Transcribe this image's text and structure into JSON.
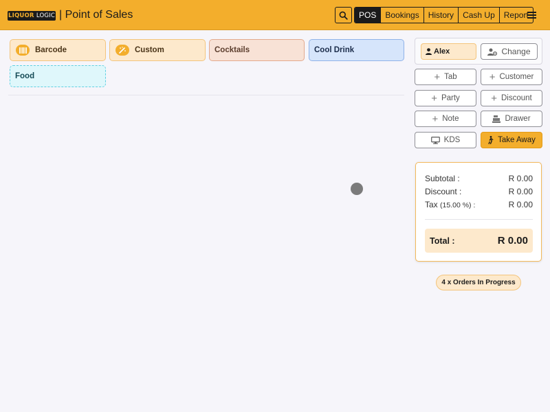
{
  "header": {
    "logo": {
      "part1": "LIQUOR",
      "part2": "LOGIC"
    },
    "title": "| Point of Sales",
    "nav": [
      {
        "label": "POS",
        "active": true
      },
      {
        "label": "Bookings"
      },
      {
        "label": "History"
      },
      {
        "label": "Cash Up"
      },
      {
        "label": "Report"
      }
    ]
  },
  "categories": {
    "barcode": "Barcode",
    "custom": "Custom",
    "cocktails": "Cocktails",
    "cooldrink": "Cool Drink",
    "food": "Food"
  },
  "user": {
    "name": "Alex",
    "change_label": "Change"
  },
  "actions": {
    "tab": "Tab",
    "customer": "Customer",
    "party": "Party",
    "discount": "Discount",
    "note": "Note",
    "drawer": "Drawer",
    "kds": "KDS",
    "takeaway": "Take Away"
  },
  "totals": {
    "subtotal_label": "Subtotal :",
    "subtotal_value": "R 0.00",
    "discount_label": "Discount :",
    "discount_value": "R 0.00",
    "tax_label": "Tax",
    "tax_rate": "(15.00 %) :",
    "tax_value": "R 0.00",
    "total_label": "Total :",
    "total_value": "R 0.00"
  },
  "orders_in_progress": "4 x Orders In Progress",
  "colors": {
    "accent": "#f3ae2c",
    "dark": "#1b1b1b"
  }
}
